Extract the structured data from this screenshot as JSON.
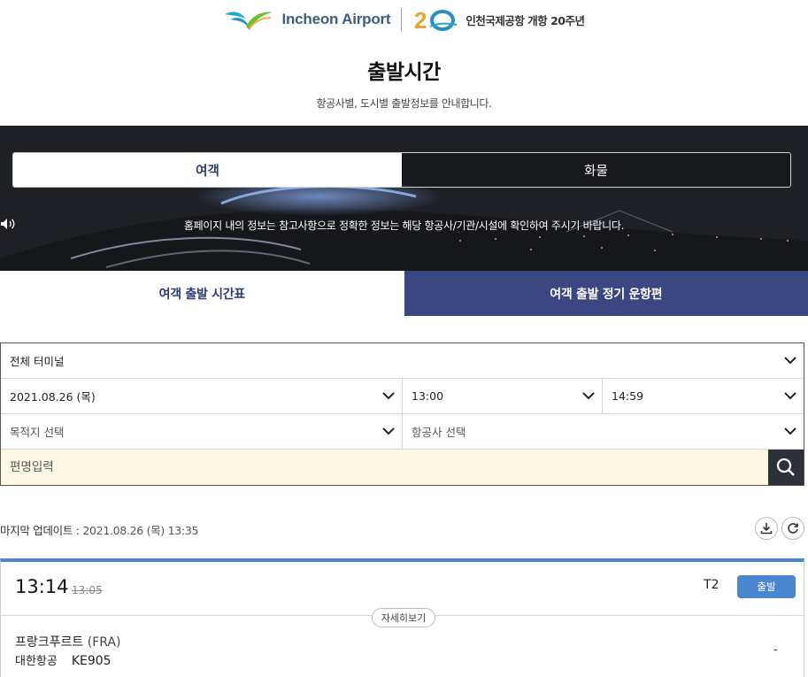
{
  "header": {
    "logo_text": "Incheon Airport",
    "anniversary_text": "인천국제공항 개항 20주년",
    "page_title": "출발시간",
    "page_subtitle": "항공사별, 도시별 출발정보를 안내합니다."
  },
  "banner": {
    "tabs": [
      {
        "label": "여객",
        "active": true
      },
      {
        "label": "화물",
        "active": false
      }
    ],
    "notice": "홈페이지 내의 정보는 참고사항으로 정확한 정보는 해당 항공사/기관/시설에 확인하여 주시기 바랍니다."
  },
  "subtabs": [
    {
      "label": "여객 출발 시간표",
      "active": true
    },
    {
      "label": "여객 출발 정기 운항편",
      "active": false
    }
  ],
  "filter": {
    "terminal": "전체 터미널",
    "date": "2021.08.26 (목)",
    "time_from": "13:00",
    "time_to": "14:59",
    "destination": "목적지 선택",
    "airline": "항공사 선택",
    "flight_placeholder": "편명입력"
  },
  "update": {
    "label": "마지막 업데이트 :",
    "value": "2021.08.26 (목) 13:35"
  },
  "flights": [
    {
      "time": "13:14",
      "scheduled_time": "13:05",
      "terminal": "T2",
      "status": "출발",
      "detail_label": "자세히보기",
      "destination": "프랑크푸르트",
      "destination_code": "(FRA)",
      "airline": "대한항공",
      "flight_no": "KE905",
      "gate": "-"
    }
  ],
  "colors": {
    "accent_blue": "#4a86d0",
    "navy": "#3a4783",
    "active_text": "#2d3b74",
    "search_bg": "#fdf8e4"
  }
}
